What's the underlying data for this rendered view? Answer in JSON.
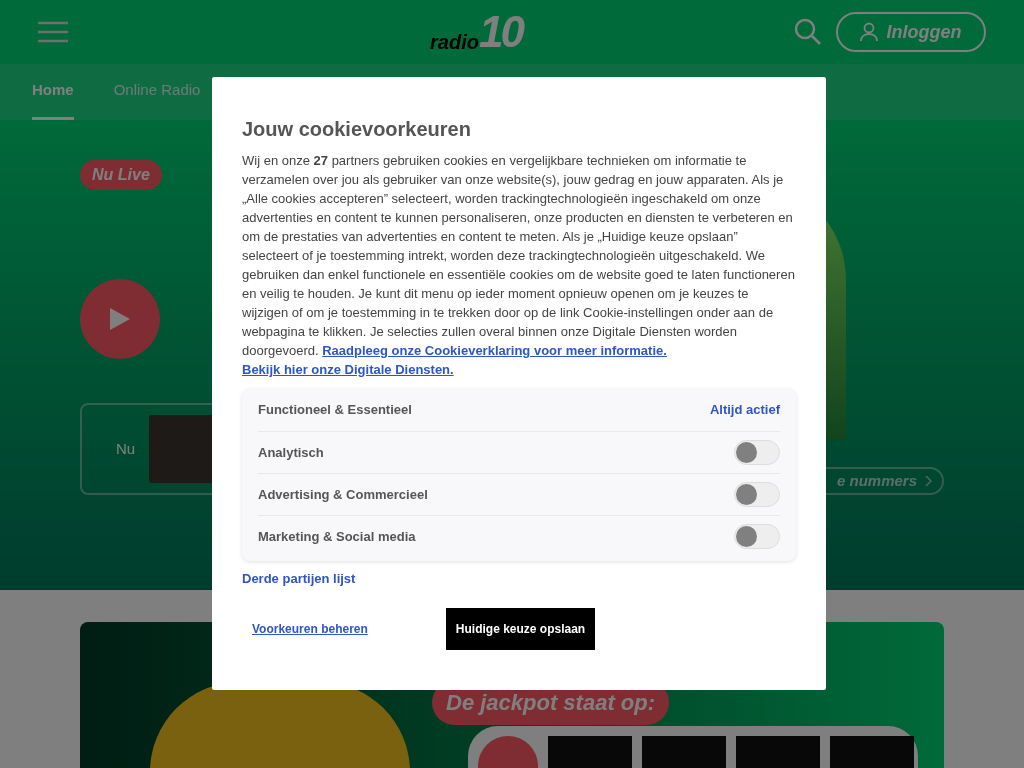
{
  "header": {
    "logo": {
      "word": "radio",
      "number": "10"
    },
    "login_button": "Inloggen"
  },
  "nav": {
    "tabs": [
      {
        "label": "Home",
        "selected": true
      },
      {
        "label": "Online Radio",
        "selected": false
      }
    ]
  },
  "hero": {
    "live_badge": "Nu Live",
    "now_label": "Nu",
    "more_button": "e nummers"
  },
  "promo": {
    "jackpot_label": "De jackpot staat op:"
  },
  "cookie_dialog": {
    "title": "Jouw cookievoorkeuren",
    "text": "Wij en onze **27** partners gebruiken cookies en vergelijkbare technieken om informatie te verzamelen over jou als gebruiker van onze website(s), jouw gedrag en jouw apparaten. Als je „Alle cookies accepteren” selecteert, worden trackingtechnologieën ingeschakeld om onze advertenties en content te kunnen personaliseren, onze producten en diensten te verbeteren en om de prestaties van advertenties en content te meten. Als je „Huidige keuze opslaan” selecteert of je toestemming intrekt, worden deze trackingtechnologieën uitgeschakeld. We gebruiken dan enkel functionele en essentiële cookies om de website goed te laten functioneren en veilig te houden. Je kunt dit menu op ieder moment opnieuw openen om je keuzes te wijzigen of om je toestemming in te trekken door op de link Cookie-instellingen onder aan de webpagina te klikken. Je selecties zullen overal binnen onze Digitale Diensten worden doorgevoerd.",
    "links": [
      "Raadpleeg onze Cookieverklaring voor meer informatie.",
      "Bekijk hier onze Digitale Diensten."
    ],
    "categories": [
      {
        "kind": "always",
        "label": "Functioneel & Essentieel",
        "status": "Altijd actief"
      },
      {
        "kind": "toggle",
        "label": "Analytisch",
        "on": false
      },
      {
        "kind": "toggle",
        "label": "Advertising & Commercieel",
        "on": false
      },
      {
        "kind": "toggle",
        "label": "Marketing & Social media",
        "on": false
      }
    ],
    "third_party_link": "Derde partijen lijst",
    "manage_link": "Voorkeuren beheren",
    "save_button": "Huidige keuze opslaan"
  }
}
